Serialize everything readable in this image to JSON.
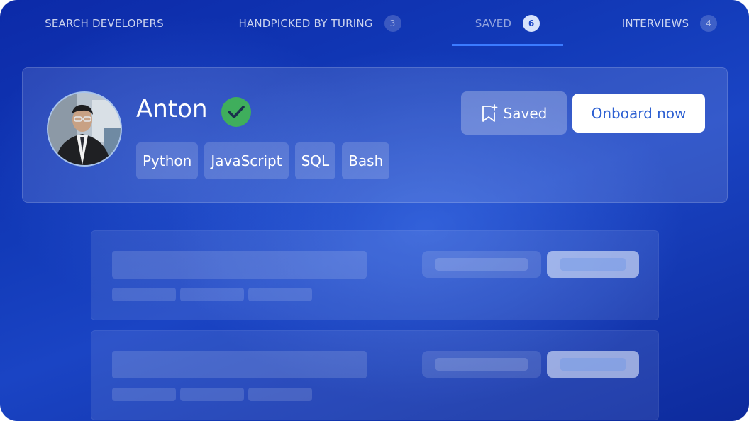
{
  "tabs": [
    {
      "label": "SEARCH DEVELOPERS",
      "count": null
    },
    {
      "label": "HANDPICKED BY TURING",
      "count": "3"
    },
    {
      "label": "SAVED",
      "count": "6"
    },
    {
      "label": "INTERVIEWS",
      "count": "4"
    }
  ],
  "active_tab": "SAVED",
  "candidate": {
    "name": "Anton",
    "verified_icon": "check-circle-icon",
    "skills": [
      "Python",
      "JavaScript",
      "SQL",
      "Bash"
    ],
    "saved_label": "Saved",
    "onboard_label": "Onboard now"
  },
  "colors": {
    "accent": "#3b7bff",
    "verified": "#3fae5c",
    "onboard_text": "#2d60d2",
    "background": "#123ab8"
  }
}
